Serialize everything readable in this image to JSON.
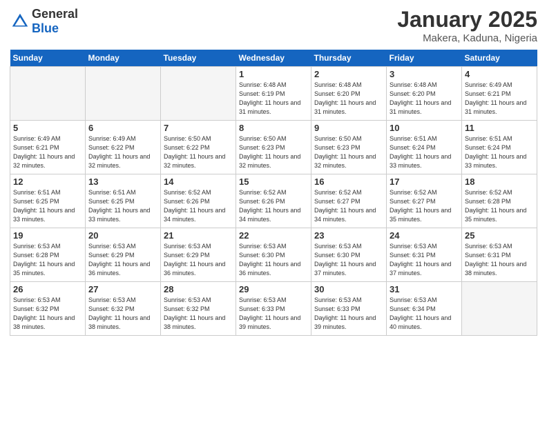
{
  "header": {
    "logo_general": "General",
    "logo_blue": "Blue",
    "month": "January 2025",
    "location": "Makera, Kaduna, Nigeria"
  },
  "days_of_week": [
    "Sunday",
    "Monday",
    "Tuesday",
    "Wednesday",
    "Thursday",
    "Friday",
    "Saturday"
  ],
  "weeks": [
    [
      {
        "day": "",
        "sunrise": "",
        "sunset": "",
        "daylight": "",
        "empty": true
      },
      {
        "day": "",
        "sunrise": "",
        "sunset": "",
        "daylight": "",
        "empty": true
      },
      {
        "day": "",
        "sunrise": "",
        "sunset": "",
        "daylight": "",
        "empty": true
      },
      {
        "day": "1",
        "sunrise": "Sunrise: 6:48 AM",
        "sunset": "Sunset: 6:19 PM",
        "daylight": "Daylight: 11 hours and 31 minutes."
      },
      {
        "day": "2",
        "sunrise": "Sunrise: 6:48 AM",
        "sunset": "Sunset: 6:20 PM",
        "daylight": "Daylight: 11 hours and 31 minutes."
      },
      {
        "day": "3",
        "sunrise": "Sunrise: 6:48 AM",
        "sunset": "Sunset: 6:20 PM",
        "daylight": "Daylight: 11 hours and 31 minutes."
      },
      {
        "day": "4",
        "sunrise": "Sunrise: 6:49 AM",
        "sunset": "Sunset: 6:21 PM",
        "daylight": "Daylight: 11 hours and 31 minutes."
      }
    ],
    [
      {
        "day": "5",
        "sunrise": "Sunrise: 6:49 AM",
        "sunset": "Sunset: 6:21 PM",
        "daylight": "Daylight: 11 hours and 32 minutes."
      },
      {
        "day": "6",
        "sunrise": "Sunrise: 6:49 AM",
        "sunset": "Sunset: 6:22 PM",
        "daylight": "Daylight: 11 hours and 32 minutes."
      },
      {
        "day": "7",
        "sunrise": "Sunrise: 6:50 AM",
        "sunset": "Sunset: 6:22 PM",
        "daylight": "Daylight: 11 hours and 32 minutes."
      },
      {
        "day": "8",
        "sunrise": "Sunrise: 6:50 AM",
        "sunset": "Sunset: 6:23 PM",
        "daylight": "Daylight: 11 hours and 32 minutes."
      },
      {
        "day": "9",
        "sunrise": "Sunrise: 6:50 AM",
        "sunset": "Sunset: 6:23 PM",
        "daylight": "Daylight: 11 hours and 32 minutes."
      },
      {
        "day": "10",
        "sunrise": "Sunrise: 6:51 AM",
        "sunset": "Sunset: 6:24 PM",
        "daylight": "Daylight: 11 hours and 33 minutes."
      },
      {
        "day": "11",
        "sunrise": "Sunrise: 6:51 AM",
        "sunset": "Sunset: 6:24 PM",
        "daylight": "Daylight: 11 hours and 33 minutes."
      }
    ],
    [
      {
        "day": "12",
        "sunrise": "Sunrise: 6:51 AM",
        "sunset": "Sunset: 6:25 PM",
        "daylight": "Daylight: 11 hours and 33 minutes."
      },
      {
        "day": "13",
        "sunrise": "Sunrise: 6:51 AM",
        "sunset": "Sunset: 6:25 PM",
        "daylight": "Daylight: 11 hours and 33 minutes."
      },
      {
        "day": "14",
        "sunrise": "Sunrise: 6:52 AM",
        "sunset": "Sunset: 6:26 PM",
        "daylight": "Daylight: 11 hours and 34 minutes."
      },
      {
        "day": "15",
        "sunrise": "Sunrise: 6:52 AM",
        "sunset": "Sunset: 6:26 PM",
        "daylight": "Daylight: 11 hours and 34 minutes."
      },
      {
        "day": "16",
        "sunrise": "Sunrise: 6:52 AM",
        "sunset": "Sunset: 6:27 PM",
        "daylight": "Daylight: 11 hours and 34 minutes."
      },
      {
        "day": "17",
        "sunrise": "Sunrise: 6:52 AM",
        "sunset": "Sunset: 6:27 PM",
        "daylight": "Daylight: 11 hours and 35 minutes."
      },
      {
        "day": "18",
        "sunrise": "Sunrise: 6:52 AM",
        "sunset": "Sunset: 6:28 PM",
        "daylight": "Daylight: 11 hours and 35 minutes."
      }
    ],
    [
      {
        "day": "19",
        "sunrise": "Sunrise: 6:53 AM",
        "sunset": "Sunset: 6:28 PM",
        "daylight": "Daylight: 11 hours and 35 minutes."
      },
      {
        "day": "20",
        "sunrise": "Sunrise: 6:53 AM",
        "sunset": "Sunset: 6:29 PM",
        "daylight": "Daylight: 11 hours and 36 minutes."
      },
      {
        "day": "21",
        "sunrise": "Sunrise: 6:53 AM",
        "sunset": "Sunset: 6:29 PM",
        "daylight": "Daylight: 11 hours and 36 minutes."
      },
      {
        "day": "22",
        "sunrise": "Sunrise: 6:53 AM",
        "sunset": "Sunset: 6:30 PM",
        "daylight": "Daylight: 11 hours and 36 minutes."
      },
      {
        "day": "23",
        "sunrise": "Sunrise: 6:53 AM",
        "sunset": "Sunset: 6:30 PM",
        "daylight": "Daylight: 11 hours and 37 minutes."
      },
      {
        "day": "24",
        "sunrise": "Sunrise: 6:53 AM",
        "sunset": "Sunset: 6:31 PM",
        "daylight": "Daylight: 11 hours and 37 minutes."
      },
      {
        "day": "25",
        "sunrise": "Sunrise: 6:53 AM",
        "sunset": "Sunset: 6:31 PM",
        "daylight": "Daylight: 11 hours and 38 minutes."
      }
    ],
    [
      {
        "day": "26",
        "sunrise": "Sunrise: 6:53 AM",
        "sunset": "Sunset: 6:32 PM",
        "daylight": "Daylight: 11 hours and 38 minutes."
      },
      {
        "day": "27",
        "sunrise": "Sunrise: 6:53 AM",
        "sunset": "Sunset: 6:32 PM",
        "daylight": "Daylight: 11 hours and 38 minutes."
      },
      {
        "day": "28",
        "sunrise": "Sunrise: 6:53 AM",
        "sunset": "Sunset: 6:32 PM",
        "daylight": "Daylight: 11 hours and 38 minutes."
      },
      {
        "day": "29",
        "sunrise": "Sunrise: 6:53 AM",
        "sunset": "Sunset: 6:33 PM",
        "daylight": "Daylight: 11 hours and 39 minutes."
      },
      {
        "day": "30",
        "sunrise": "Sunrise: 6:53 AM",
        "sunset": "Sunset: 6:33 PM",
        "daylight": "Daylight: 11 hours and 39 minutes."
      },
      {
        "day": "31",
        "sunrise": "Sunrise: 6:53 AM",
        "sunset": "Sunset: 6:34 PM",
        "daylight": "Daylight: 11 hours and 40 minutes."
      },
      {
        "day": "",
        "sunrise": "",
        "sunset": "",
        "daylight": "",
        "empty": true
      }
    ]
  ]
}
